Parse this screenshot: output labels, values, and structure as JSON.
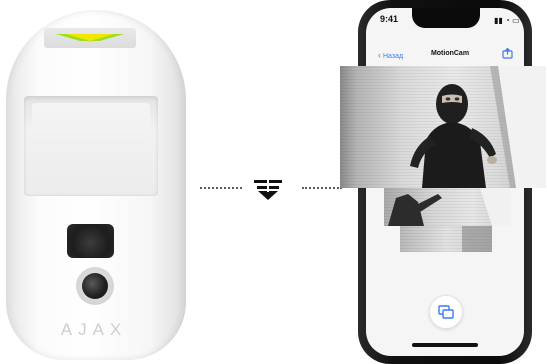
{
  "detector": {
    "brand": "AJAX",
    "led_color": "#f2e600",
    "led_glow_color": "#7fd200"
  },
  "connector": {
    "icon": "transfer-arrow-icon"
  },
  "phone": {
    "status_time": "9:41",
    "status_icons": "▮▮ ◔ ▭",
    "nav": {
      "back_label": "Назад",
      "title": "MotionCam",
      "action_icon": "share-icon"
    },
    "gallery_button_icon": "gallery-icon",
    "accent_color": "#3b7cf0"
  }
}
